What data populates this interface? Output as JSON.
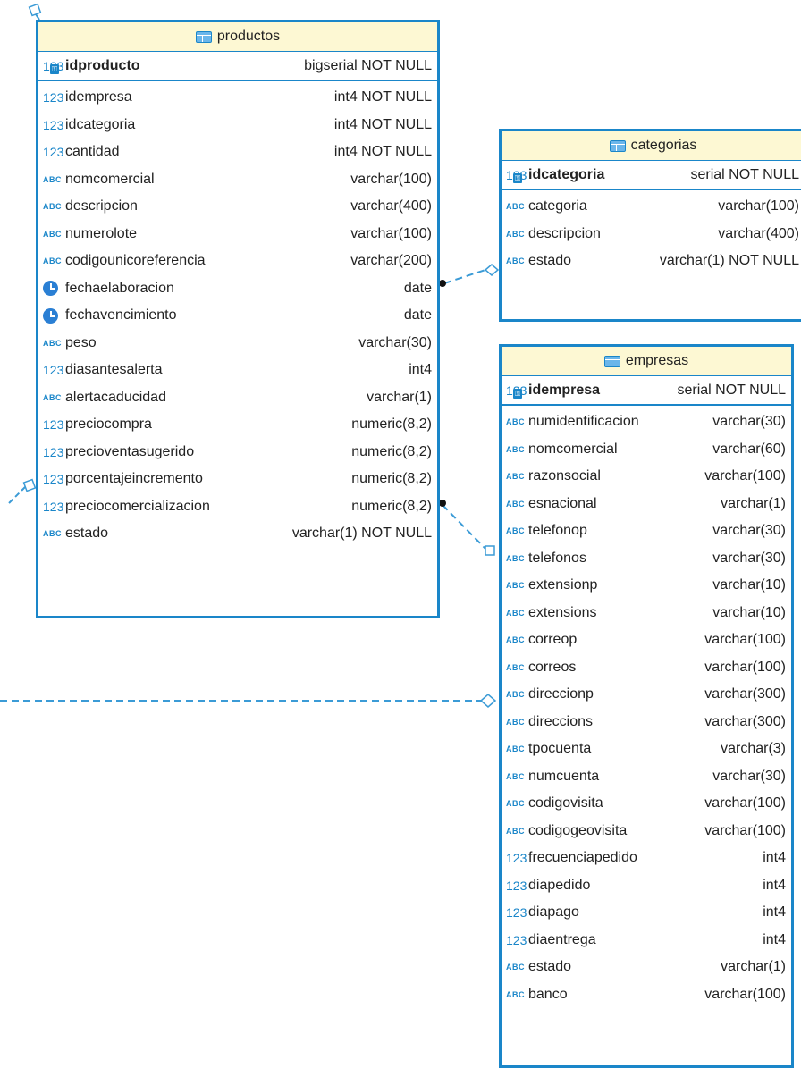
{
  "tables": [
    {
      "id": "productos",
      "name": "productos",
      "pk": {
        "name": "idproducto",
        "type": "bigserial NOT NULL"
      },
      "columns": [
        {
          "icon": "int",
          "name": "idempresa",
          "type": "int4 NOT NULL"
        },
        {
          "icon": "int",
          "name": "idcategoria",
          "type": "int4 NOT NULL"
        },
        {
          "icon": "int",
          "name": "cantidad",
          "type": "int4 NOT NULL"
        },
        {
          "icon": "abc",
          "name": "nomcomercial",
          "type": "varchar(100)"
        },
        {
          "icon": "abc",
          "name": "descripcion",
          "type": "varchar(400)"
        },
        {
          "icon": "abc",
          "name": "numerolote",
          "type": "varchar(100)"
        },
        {
          "icon": "abc",
          "name": "codigounicoreferencia",
          "type": "varchar(200)"
        },
        {
          "icon": "date",
          "name": "fechaelaboracion",
          "type": "date"
        },
        {
          "icon": "date",
          "name": "fechavencimiento",
          "type": "date"
        },
        {
          "icon": "abc",
          "name": "peso",
          "type": "varchar(30)"
        },
        {
          "icon": "int",
          "name": "diasantesalerta",
          "type": "int4"
        },
        {
          "icon": "abc",
          "name": "alertacaducidad",
          "type": "varchar(1)"
        },
        {
          "icon": "int",
          "name": "preciocompra",
          "type": "numeric(8,2)"
        },
        {
          "icon": "int",
          "name": "precioventasugerido",
          "type": "numeric(8,2)"
        },
        {
          "icon": "int",
          "name": "porcentajeincremento",
          "type": "numeric(8,2)"
        },
        {
          "icon": "int",
          "name": "preciocomercializacion",
          "type": "numeric(8,2)"
        },
        {
          "icon": "abc",
          "name": "estado",
          "type": "varchar(1) NOT NULL"
        }
      ]
    },
    {
      "id": "categorias",
      "name": "categorias",
      "pk": {
        "name": "idcategoria",
        "type": "serial NOT NULL"
      },
      "columns": [
        {
          "icon": "abc",
          "name": "categoria",
          "type": "varchar(100)"
        },
        {
          "icon": "abc",
          "name": "descripcion",
          "type": "varchar(400)"
        },
        {
          "icon": "abc",
          "name": "estado",
          "type": "varchar(1) NOT NULL"
        }
      ]
    },
    {
      "id": "empresas",
      "name": "empresas",
      "pk": {
        "name": "idempresa",
        "type": "serial NOT NULL"
      },
      "columns": [
        {
          "icon": "abc",
          "name": "numidentificacion",
          "type": "varchar(30)"
        },
        {
          "icon": "abc",
          "name": "nomcomercial",
          "type": "varchar(60)"
        },
        {
          "icon": "abc",
          "name": "razonsocial",
          "type": "varchar(100)"
        },
        {
          "icon": "abc",
          "name": "esnacional",
          "type": "varchar(1)"
        },
        {
          "icon": "abc",
          "name": "telefonop",
          "type": "varchar(30)"
        },
        {
          "icon": "abc",
          "name": "telefonos",
          "type": "varchar(30)"
        },
        {
          "icon": "abc",
          "name": "extensionp",
          "type": "varchar(10)"
        },
        {
          "icon": "abc",
          "name": "extensions",
          "type": "varchar(10)"
        },
        {
          "icon": "abc",
          "name": "correop",
          "type": "varchar(100)"
        },
        {
          "icon": "abc",
          "name": "correos",
          "type": "varchar(100)"
        },
        {
          "icon": "abc",
          "name": "direccionp",
          "type": "varchar(300)"
        },
        {
          "icon": "abc",
          "name": "direccions",
          "type": "varchar(300)"
        },
        {
          "icon": "abc",
          "name": "tpocuenta",
          "type": "varchar(3)"
        },
        {
          "icon": "abc",
          "name": "numcuenta",
          "type": "varchar(30)"
        },
        {
          "icon": "abc",
          "name": "codigovisita",
          "type": "varchar(100)"
        },
        {
          "icon": "abc",
          "name": "codigogeovisita",
          "type": "varchar(100)"
        },
        {
          "icon": "int",
          "name": "frecuenciapedido",
          "type": "int4"
        },
        {
          "icon": "int",
          "name": "diapedido",
          "type": "int4"
        },
        {
          "icon": "int",
          "name": "diapago",
          "type": "int4"
        },
        {
          "icon": "int",
          "name": "diaentrega",
          "type": "int4"
        },
        {
          "icon": "abc",
          "name": "estado",
          "type": "varchar(1)"
        },
        {
          "icon": "abc",
          "name": "banco",
          "type": "varchar(100)"
        }
      ]
    }
  ],
  "icons": {
    "int": "123",
    "abc": "ABC",
    "key_badge": "123",
    "table": "table-icon",
    "date": "clock-icon"
  },
  "colors": {
    "border": "#1a86c9",
    "header_bg": "#fdf8d3",
    "connector": "#3b9bd6"
  }
}
